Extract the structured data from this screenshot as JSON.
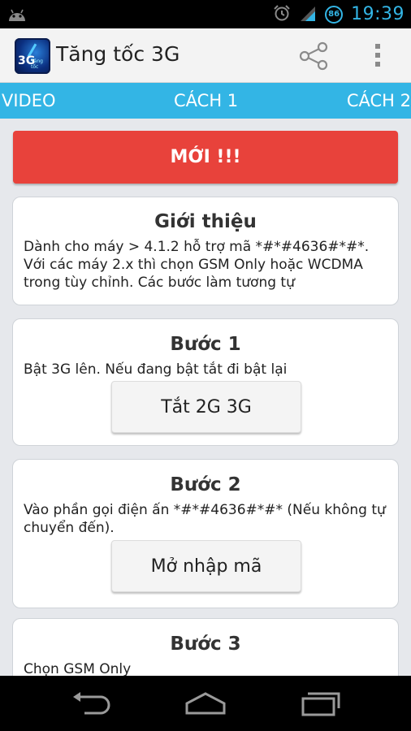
{
  "status_bar": {
    "time": "19:39",
    "battery_level": "86"
  },
  "app": {
    "title": "Tăng tốc 3G",
    "icon_text": "3G",
    "icon_subtext": "Tăng tốc"
  },
  "tabs": [
    {
      "label": "VIDEO"
    },
    {
      "label": "CÁCH 1"
    },
    {
      "label": "CÁCH 2"
    }
  ],
  "new_button": {
    "label": "MỚI !!!"
  },
  "cards": {
    "intro": {
      "title": "Giới thiệu",
      "text": "Dành cho máy > 4.1.2 hỗ trợ mã *#*#4636#*#*. Với các máy 2.x thì chọn GSM Only hoặc WCDMA trong tùy chỉnh. Các bước làm tương tự"
    },
    "step1": {
      "title": "Bước 1",
      "text": "Bật 3G lên. Nếu đang bật tắt đi bật lại",
      "button": "Tắt 2G  3G"
    },
    "step2": {
      "title": "Bước 2",
      "text": "Vào phần gọi điện ấn *#*#4636#*#* (Nếu không tự chuyển đến).",
      "button": "Mở nhập mã"
    },
    "step3": {
      "title": "Bước 3",
      "text": "Chọn GSM Only"
    }
  },
  "colors": {
    "accent": "#33b5e5",
    "new_button": "#e8423b"
  }
}
